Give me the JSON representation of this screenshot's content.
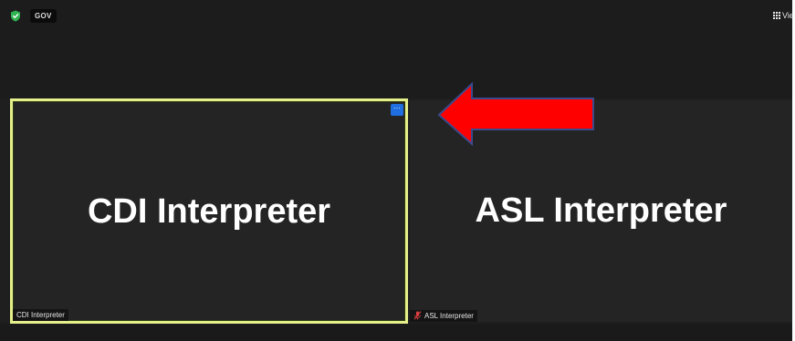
{
  "topbar": {
    "shield_icon": "shield-check-icon",
    "gov_badge": "GOV",
    "view_label": "Vie",
    "view_icon": "grid-icon"
  },
  "tiles": [
    {
      "id": "cdi",
      "display_name": "CDI Interpreter",
      "name_tag": "CDI Interpreter",
      "more_button": "···",
      "highlight_color": "#e6f08a"
    },
    {
      "id": "asl",
      "display_name": "ASL Interpreter",
      "name_tag": "ASL Interpreter",
      "mic_icon": "mic-muted-icon"
    }
  ],
  "annotation": {
    "arrow_icon": "arrow-left-icon",
    "arrow_color": "#ff0000",
    "arrow_outline": "#3a4a8c"
  },
  "colors": {
    "background": "#1c1c1c",
    "tile": "#242424",
    "more_button": "#1f6fe0"
  }
}
